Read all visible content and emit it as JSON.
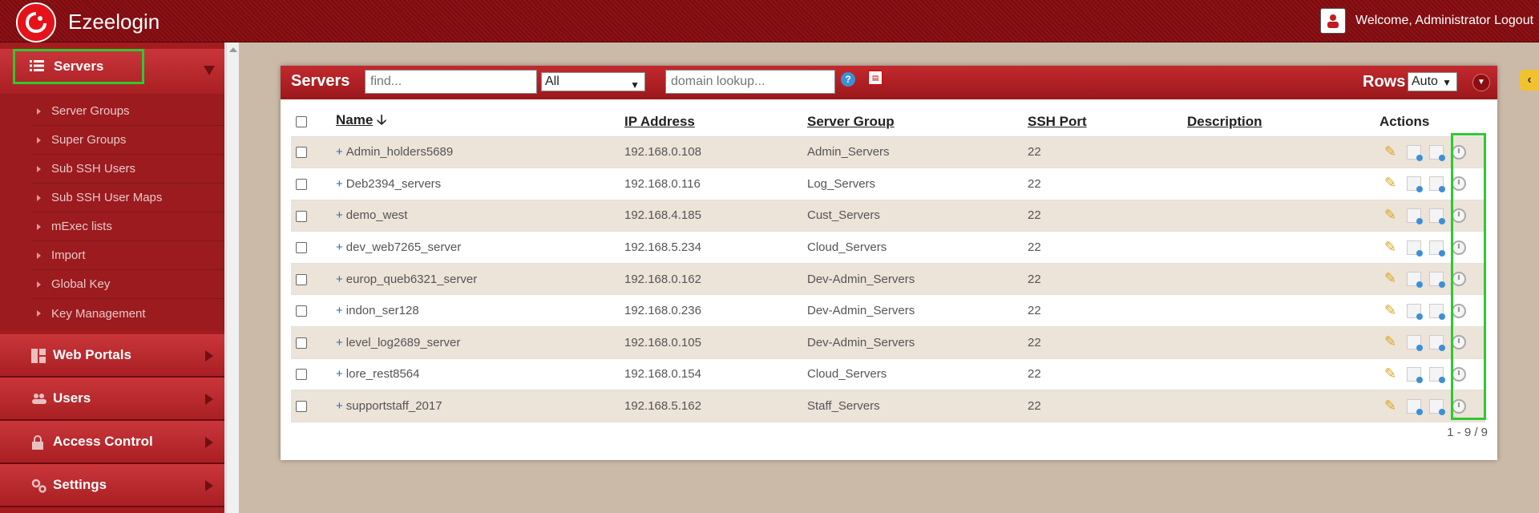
{
  "header": {
    "brand": "Ezeelogin",
    "welcome": "Welcome, Administrator",
    "logout": "Logout"
  },
  "sidebar": {
    "sections": [
      {
        "label": "Servers",
        "icon": "list-icon",
        "expanded": true,
        "items": [
          "Server Groups",
          "Super Groups",
          "Sub SSH Users",
          "Sub SSH User Maps",
          "mExec lists",
          "Import",
          "Global Key",
          "Key Management"
        ]
      },
      {
        "label": "Web Portals",
        "icon": "dashboard-icon"
      },
      {
        "label": "Users",
        "icon": "users-icon"
      },
      {
        "label": "Access Control",
        "icon": "lock-icon"
      },
      {
        "label": "Settings",
        "icon": "gears-icon"
      }
    ]
  },
  "panel": {
    "title": "Servers",
    "find_placeholder": "find...",
    "filter_value": "All",
    "domain_placeholder": "domain lookup...",
    "help": "?",
    "rows_label": "Rows",
    "rows_value": "Auto",
    "pagination": "1 - 9 / 9"
  },
  "table": {
    "columns": [
      "Name",
      "IP Address",
      "Server Group",
      "SSH Port",
      "Description",
      "Actions"
    ],
    "rows": [
      {
        "name": "Admin_holders5689",
        "ip": "192.168.0.108",
        "group": "Admin_Servers",
        "port": "22",
        "description": ""
      },
      {
        "name": "Deb2394_servers",
        "ip": "192.168.0.116",
        "group": "Log_Servers",
        "port": "22",
        "description": ""
      },
      {
        "name": "demo_west",
        "ip": "192.168.4.185",
        "group": "Cust_Servers",
        "port": "22",
        "description": ""
      },
      {
        "name": "dev_web7265_server",
        "ip": "192.168.5.234",
        "group": "Cloud_Servers",
        "port": "22",
        "description": ""
      },
      {
        "name": "europ_queb6321_server",
        "ip": "192.168.0.162",
        "group": "Dev-Admin_Servers",
        "port": "22",
        "description": ""
      },
      {
        "name": "indon_ser128",
        "ip": "192.168.0.236",
        "group": "Dev-Admin_Servers",
        "port": "22",
        "description": ""
      },
      {
        "name": "level_log2689_server",
        "ip": "192.168.0.105",
        "group": "Dev-Admin_Servers",
        "port": "22",
        "description": ""
      },
      {
        "name": "lore_rest8564",
        "ip": "192.168.0.154",
        "group": "Cloud_Servers",
        "port": "22",
        "description": ""
      },
      {
        "name": "supportstaff_2017",
        "ip": "192.168.5.162",
        "group": "Staff_Servers",
        "port": "22",
        "description": ""
      }
    ]
  },
  "colors": {
    "brand_red": "#a51c20",
    "highlight_green": "#2ec930"
  }
}
